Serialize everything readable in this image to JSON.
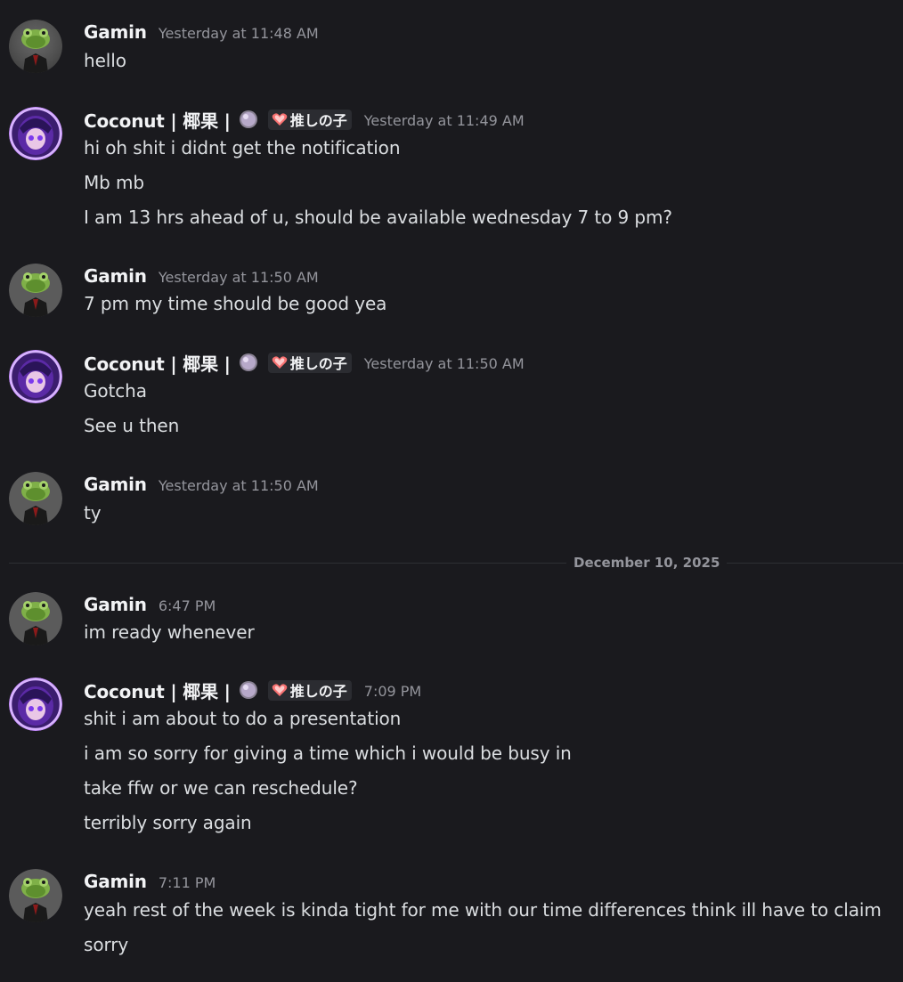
{
  "users": {
    "gamin": {
      "name": "Gamin",
      "avatar": "frog-avatar"
    },
    "coconut": {
      "name": "Coconut | 椰果 |",
      "avatar": "anime-girl-avatar",
      "tag": "推しの子"
    }
  },
  "divider": {
    "label": "December 10, 2025"
  },
  "messages": [
    {
      "author": "Gamin",
      "time": "Yesterday at 11:48 AM",
      "lines": [
        "hello"
      ]
    },
    {
      "author": "Coconut | 椰果 |",
      "time": "Yesterday at 11:49 AM",
      "lines": [
        "hi oh shit i didnt get the notification",
        "Mb mb",
        "I am 13 hrs ahead of u, should be available wednesday 7 to 9 pm?"
      ]
    },
    {
      "author": "Gamin",
      "time": "Yesterday at 11:50 AM",
      "lines": [
        "7 pm my time should be good yea"
      ]
    },
    {
      "author": "Coconut | 椰果 |",
      "time": "Yesterday at 11:50 AM",
      "lines": [
        "Gotcha",
        "See u then"
      ]
    },
    {
      "author": "Gamin",
      "time": "Yesterday at 11:50 AM",
      "lines": [
        "ty"
      ]
    },
    {
      "author": "Gamin",
      "time": "6:47 PM",
      "lines": [
        "im ready whenever"
      ]
    },
    {
      "author": "Coconut | 椰果 |",
      "time": "7:09 PM",
      "lines": [
        "shit i am about to do a presentation",
        "i am so sorry for giving a time which i would be busy in",
        "take ffw or we can reschedule?",
        "terribly sorry again"
      ]
    },
    {
      "author": "Gamin",
      "time": "7:11 PM",
      "lines": [
        "yeah rest of the week is kinda tight for me with our time differences think ill have to claim",
        "sorry"
      ]
    }
  ],
  "colors": {
    "background": "#1a1a1e",
    "username": "#f2f3f5",
    "text": "#dbdee1",
    "timestamp": "#94959c",
    "avatar_glow": "#a855f7"
  }
}
